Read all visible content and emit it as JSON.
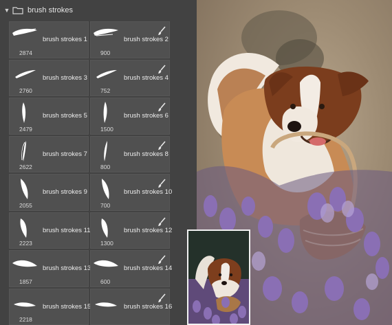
{
  "panel": {
    "folder_name": "brush strokes",
    "brushes": [
      {
        "name": "brush strokes 1",
        "size": "2874"
      },
      {
        "name": "brush strokes 2",
        "size": "900"
      },
      {
        "name": "brush strokes 3",
        "size": "2760"
      },
      {
        "name": "brush strokes 4",
        "size": "752"
      },
      {
        "name": "brush strokes 5",
        "size": "2479"
      },
      {
        "name": "brush strokes 6",
        "size": "1500"
      },
      {
        "name": "brush strokes 7",
        "size": "2622"
      },
      {
        "name": "brush strokes 8",
        "size": "800"
      },
      {
        "name": "brush strokes 9",
        "size": "2055"
      },
      {
        "name": "brush strokes 10",
        "size": "700"
      },
      {
        "name": "brush strokes 11",
        "size": "2223"
      },
      {
        "name": "brush strokes 12",
        "size": "1300"
      },
      {
        "name": "brush strokes 13",
        "size": "1857"
      },
      {
        "name": "brush strokes 14",
        "size": "600"
      },
      {
        "name": "brush strokes 15",
        "size": "2218"
      },
      {
        "name": "brush strokes 16",
        "size": ""
      }
    ],
    "icons": {
      "collapse": "chevron-down-icon",
      "folder": "folder-icon",
      "brush": "paintbrush-icon"
    }
  },
  "artwork": {
    "subject": "dog-with-lavender-basket",
    "colors": {
      "background": "#a08d74",
      "dog_fur": "#8a4a22",
      "lavender": "#8a6fb4"
    }
  }
}
